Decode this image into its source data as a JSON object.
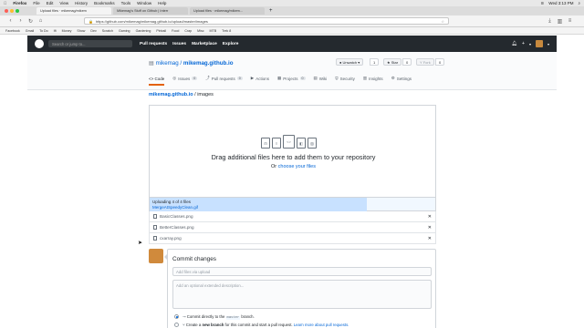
{
  "mac_menu": {
    "apple": "",
    "items": [
      "Firefox",
      "File",
      "Edit",
      "View",
      "History",
      "Bookmarks",
      "Tools",
      "Window",
      "Help"
    ],
    "clock": "Wed 3:13 PM"
  },
  "browser": {
    "tabs": [
      {
        "title": "Upload files · mikemag/mikem"
      },
      {
        "title": "Mikemag's Stuff on Github | Interr"
      },
      {
        "title": "Upload files · mikemag/mikem..."
      }
    ],
    "url": "https://github.com/mikemag/mikemag.github.io/upload/master/images",
    "bookmarks": [
      "Facebook",
      "Gmail",
      "To Do",
      "Ift",
      "Money",
      "Show",
      "Dev",
      "Scratch",
      "Gaming",
      "Gardening",
      "Pinball",
      "Food",
      "Crap",
      "Misc",
      "MTB",
      "Trek 8"
    ]
  },
  "github_header": {
    "search_placeholder": "Search or jump to...",
    "nav": [
      "Pull requests",
      "Issues",
      "Marketplace",
      "Explore"
    ],
    "plus": "+",
    "caret": "▾"
  },
  "repo": {
    "owner": "mikemag",
    "separator": " / ",
    "name": "mikemag.github.io",
    "actions": [
      {
        "label": "● Unwatch ▾",
        "count": "1"
      },
      {
        "label": "★ Star",
        "count": "0"
      },
      {
        "label": "Y Fork",
        "count": "0"
      }
    ],
    "tabs": [
      {
        "label": "<> Code",
        "count": "",
        "selected": true
      },
      {
        "label": "Issues",
        "count": "0"
      },
      {
        "label": "Pull requests",
        "count": "0"
      },
      {
        "label": "Actions",
        "count": ""
      },
      {
        "label": "Projects",
        "count": "0"
      },
      {
        "label": "Wiki",
        "count": ""
      },
      {
        "label": "Security",
        "count": ""
      },
      {
        "label": "Insights",
        "count": ""
      },
      {
        "label": "Settings",
        "count": ""
      }
    ]
  },
  "breadcrumb": {
    "repo_link": "mikemag.github.io",
    "sep": " / ",
    "folder": "images"
  },
  "dropzone": {
    "message": "Drag additional files here to add them to your repository",
    "or": "Or ",
    "choose": "choose your files"
  },
  "upload": {
    "status": "Uploading 4 of 4 files",
    "current_file": "MergeAtSpeedyClean.gif",
    "progress_fraction": 0.76
  },
  "files": [
    {
      "name": "BasicClasses.png"
    },
    {
      "name": "BetterClasses.png"
    },
    {
      "name": "cxarray.png"
    }
  ],
  "commit": {
    "heading": "Commit changes",
    "summary_placeholder": "Add files via upload",
    "description_placeholder": "Add an optional extended description...",
    "option1_prefix": "Commit directly to the ",
    "branch": "master",
    "option1_suffix": " branch.",
    "option2_prefix": "Create a ",
    "option2_bold": "new branch",
    "option2_mid": " for this commit and start a pull request. ",
    "option2_link": "Learn more about pull requests."
  },
  "colors": {
    "link": "#0366d6",
    "header": "#24292e",
    "accent": "#e36209"
  }
}
